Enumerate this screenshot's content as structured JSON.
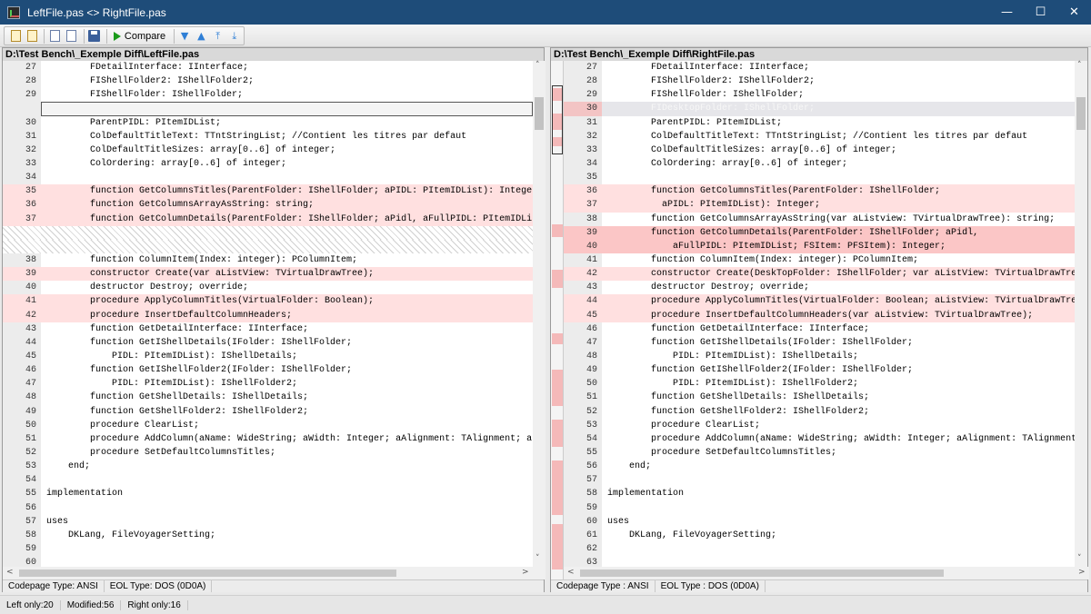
{
  "window": {
    "title": "LeftFile.pas <> RightFile.pas",
    "minimize": "—",
    "maximize": "☐",
    "close": "✕"
  },
  "toolbar": {
    "compare_label": "Compare",
    "buttons": [
      "open-left",
      "open-right",
      "copy-left",
      "copy-right",
      "save",
      "compare",
      "next-diff",
      "prev-diff",
      "first-diff",
      "last-diff"
    ]
  },
  "left_pane": {
    "path": "D:\\Test Bench\\_Exemple Diff\\LeftFile.pas",
    "codepage": "Codepage Type: ANSI",
    "eol": "EOL Type: DOS (0D0A)",
    "lines": [
      {
        "n": "27",
        "t": "        FDetailInterface: IInterface;",
        "s": ""
      },
      {
        "n": "28",
        "t": "        FIShellFolder2: IShellFolder2;",
        "s": ""
      },
      {
        "n": "29",
        "t": "        FIShellFolder: IShellFolder;",
        "s": ""
      },
      {
        "n": "",
        "t": "",
        "s": "sel"
      },
      {
        "n": "30",
        "t": "        ParentPIDL: PItemIDList;",
        "s": ""
      },
      {
        "n": "31",
        "t": "        ColDefaultTitleText: TTntStringList; //Contient les titres par defaut",
        "s": ""
      },
      {
        "n": "32",
        "t": "        ColDefaultTitleSizes: array[0..6] of integer;",
        "s": ""
      },
      {
        "n": "33",
        "t": "        ColOrdering: array[0..6] of integer;",
        "s": ""
      },
      {
        "n": "34",
        "t": "",
        "s": ""
      },
      {
        "n": "35",
        "t": "        function GetColumnsTitles(ParentFolder: IShellFolder; aPIDL: PItemIDList): Integer;",
        "s": "mod"
      },
      {
        "n": "36",
        "t": "        function GetColumnsArrayAsString: string;",
        "s": "mod"
      },
      {
        "n": "37",
        "t": "        function GetColumnDetails(ParentFolder: IShellFolder; aPidl, aFullPIDL: PItemIDList",
        "s": "mod"
      },
      {
        "n": "",
        "t": "",
        "s": "hatch"
      },
      {
        "n": "",
        "t": "",
        "s": "hatch"
      },
      {
        "n": "38",
        "t": "        function ColumnItem(Index: integer): PColumnItem;",
        "s": ""
      },
      {
        "n": "39",
        "t": "        constructor Create(var aListView: TVirtualDrawTree);",
        "s": "mod"
      },
      {
        "n": "40",
        "t": "        destructor Destroy; override;",
        "s": ""
      },
      {
        "n": "41",
        "t": "        procedure ApplyColumnTitles(VirtualFolder: Boolean);",
        "s": "mod"
      },
      {
        "n": "42",
        "t": "        procedure InsertDefaultColumnHeaders;",
        "s": "mod"
      },
      {
        "n": "43",
        "t": "        function GetDetailInterface: IInterface;",
        "s": ""
      },
      {
        "n": "44",
        "t": "        function GetIShellDetails(IFolder: IShellFolder;",
        "s": ""
      },
      {
        "n": "45",
        "t": "            PIDL: PItemIDList): IShellDetails;",
        "s": ""
      },
      {
        "n": "46",
        "t": "        function GetIShellFolder2(IFolder: IShellFolder;",
        "s": ""
      },
      {
        "n": "47",
        "t": "            PIDL: PItemIDList): IShellFolder2;",
        "s": ""
      },
      {
        "n": "48",
        "t": "        function GetShellDetails: IShellDetails;",
        "s": ""
      },
      {
        "n": "49",
        "t": "        function GetShellFolder2: IShellFolder2;",
        "s": ""
      },
      {
        "n": "50",
        "t": "        procedure ClearList;",
        "s": ""
      },
      {
        "n": "51",
        "t": "        procedure AddColumn(aName: WideString; aWidth: Integer; aAlignment: TAlignment; aI",
        "s": ""
      },
      {
        "n": "52",
        "t": "        procedure SetDefaultColumnsTitles;",
        "s": ""
      },
      {
        "n": "53",
        "t": "    end;",
        "s": ""
      },
      {
        "n": "54",
        "t": "",
        "s": ""
      },
      {
        "n": "55",
        "t": "implementation",
        "s": ""
      },
      {
        "n": "56",
        "t": "",
        "s": ""
      },
      {
        "n": "57",
        "t": "uses",
        "s": ""
      },
      {
        "n": "58",
        "t": "    DKLang, FileVoyagerSetting;",
        "s": ""
      },
      {
        "n": "59",
        "t": "",
        "s": ""
      },
      {
        "n": "60",
        "t": "",
        "s": ""
      }
    ]
  },
  "right_pane": {
    "path": "D:\\Test Bench\\_Exemple Diff\\RightFile.pas",
    "codepage": "Codepage Type : ANSI",
    "eol": "EOL Type : DOS (0D0A)",
    "lines": [
      {
        "n": "27",
        "t": "        FDetailInterface: IInterface;",
        "s": ""
      },
      {
        "n": "28",
        "t": "        FIShellFolder2: IShellFolder2;",
        "s": ""
      },
      {
        "n": "29",
        "t": "        FIShellFolder: IShellFolder;",
        "s": ""
      },
      {
        "n": "30",
        "t": "        FIDesktopFolder: IShellFolder;",
        "s": "ghost"
      },
      {
        "n": "31",
        "t": "        ParentPIDL: PItemIDList;",
        "s": ""
      },
      {
        "n": "32",
        "t": "        ColDefaultTitleText: TTntStringList; //Contient les titres par defaut",
        "s": ""
      },
      {
        "n": "33",
        "t": "        ColDefaultTitleSizes: array[0..6] of integer;",
        "s": ""
      },
      {
        "n": "34",
        "t": "        ColOrdering: array[0..6] of integer;",
        "s": ""
      },
      {
        "n": "35",
        "t": "",
        "s": ""
      },
      {
        "n": "36",
        "t": "        function GetColumnsTitles(ParentFolder: IShellFolder;",
        "s": "mod"
      },
      {
        "n": "37",
        "t": "          aPIDL: PItemIDList): Integer;",
        "s": "mod"
      },
      {
        "n": "38",
        "t": "        function GetColumnsArrayAsString(var aListview: TVirtualDrawTree): string;",
        "s": ""
      },
      {
        "n": "39",
        "t": "        function GetColumnDetails(ParentFolder: IShellFolder; aPidl,",
        "s": "mod strong"
      },
      {
        "n": "40",
        "t": "            aFullPIDL: PItemIDList; FSItem: PFSItem): Integer;",
        "s": "mod strong"
      },
      {
        "n": "41",
        "t": "        function ColumnItem(Index: integer): PColumnItem;",
        "s": ""
      },
      {
        "n": "42",
        "t": "        constructor Create(DeskTopFolder: IShellFolder; var aListView: TVirtualDrawTree",
        "s": "mod"
      },
      {
        "n": "43",
        "t": "        destructor Destroy; override;",
        "s": ""
      },
      {
        "n": "44",
        "t": "        procedure ApplyColumnTitles(VirtualFolder: Boolean; aListView: TVirtualDrawTree",
        "s": "mod"
      },
      {
        "n": "45",
        "t": "        procedure InsertDefaultColumnHeaders(var aListview: TVirtualDrawTree);",
        "s": "mod"
      },
      {
        "n": "46",
        "t": "        function GetDetailInterface: IInterface;",
        "s": ""
      },
      {
        "n": "47",
        "t": "        function GetIShellDetails(IFolder: IShellFolder;",
        "s": ""
      },
      {
        "n": "48",
        "t": "            PIDL: PItemIDList): IShellDetails;",
        "s": ""
      },
      {
        "n": "49",
        "t": "        function GetIShellFolder2(IFolder: IShellFolder;",
        "s": ""
      },
      {
        "n": "50",
        "t": "            PIDL: PItemIDList): IShellFolder2;",
        "s": ""
      },
      {
        "n": "51",
        "t": "        function GetShellDetails: IShellDetails;",
        "s": ""
      },
      {
        "n": "52",
        "t": "        function GetShellFolder2: IShellFolder2;",
        "s": ""
      },
      {
        "n": "53",
        "t": "        procedure ClearList;",
        "s": ""
      },
      {
        "n": "54",
        "t": "        procedure AddColumn(aName: WideString; aWidth: Integer; aAlignment: TAlignment;",
        "s": ""
      },
      {
        "n": "55",
        "t": "        procedure SetDefaultColumnsTitles;",
        "s": ""
      },
      {
        "n": "56",
        "t": "    end;",
        "s": ""
      },
      {
        "n": "57",
        "t": "",
        "s": ""
      },
      {
        "n": "58",
        "t": "implementation",
        "s": ""
      },
      {
        "n": "59",
        "t": "",
        "s": ""
      },
      {
        "n": "60",
        "t": "uses",
        "s": ""
      },
      {
        "n": "61",
        "t": "    DKLang, FileVoyagerSetting;",
        "s": ""
      },
      {
        "n": "62",
        "t": "",
        "s": ""
      },
      {
        "n": "63",
        "t": "",
        "s": ""
      }
    ]
  },
  "status": {
    "left_only": "Left only:20",
    "modified": "Modified:56",
    "right_only": "Right only:16"
  },
  "colors": {
    "titlebar": "#1e4c79",
    "modified_line": "#ffe0e0",
    "modified_strong": "#fbc6c6"
  }
}
